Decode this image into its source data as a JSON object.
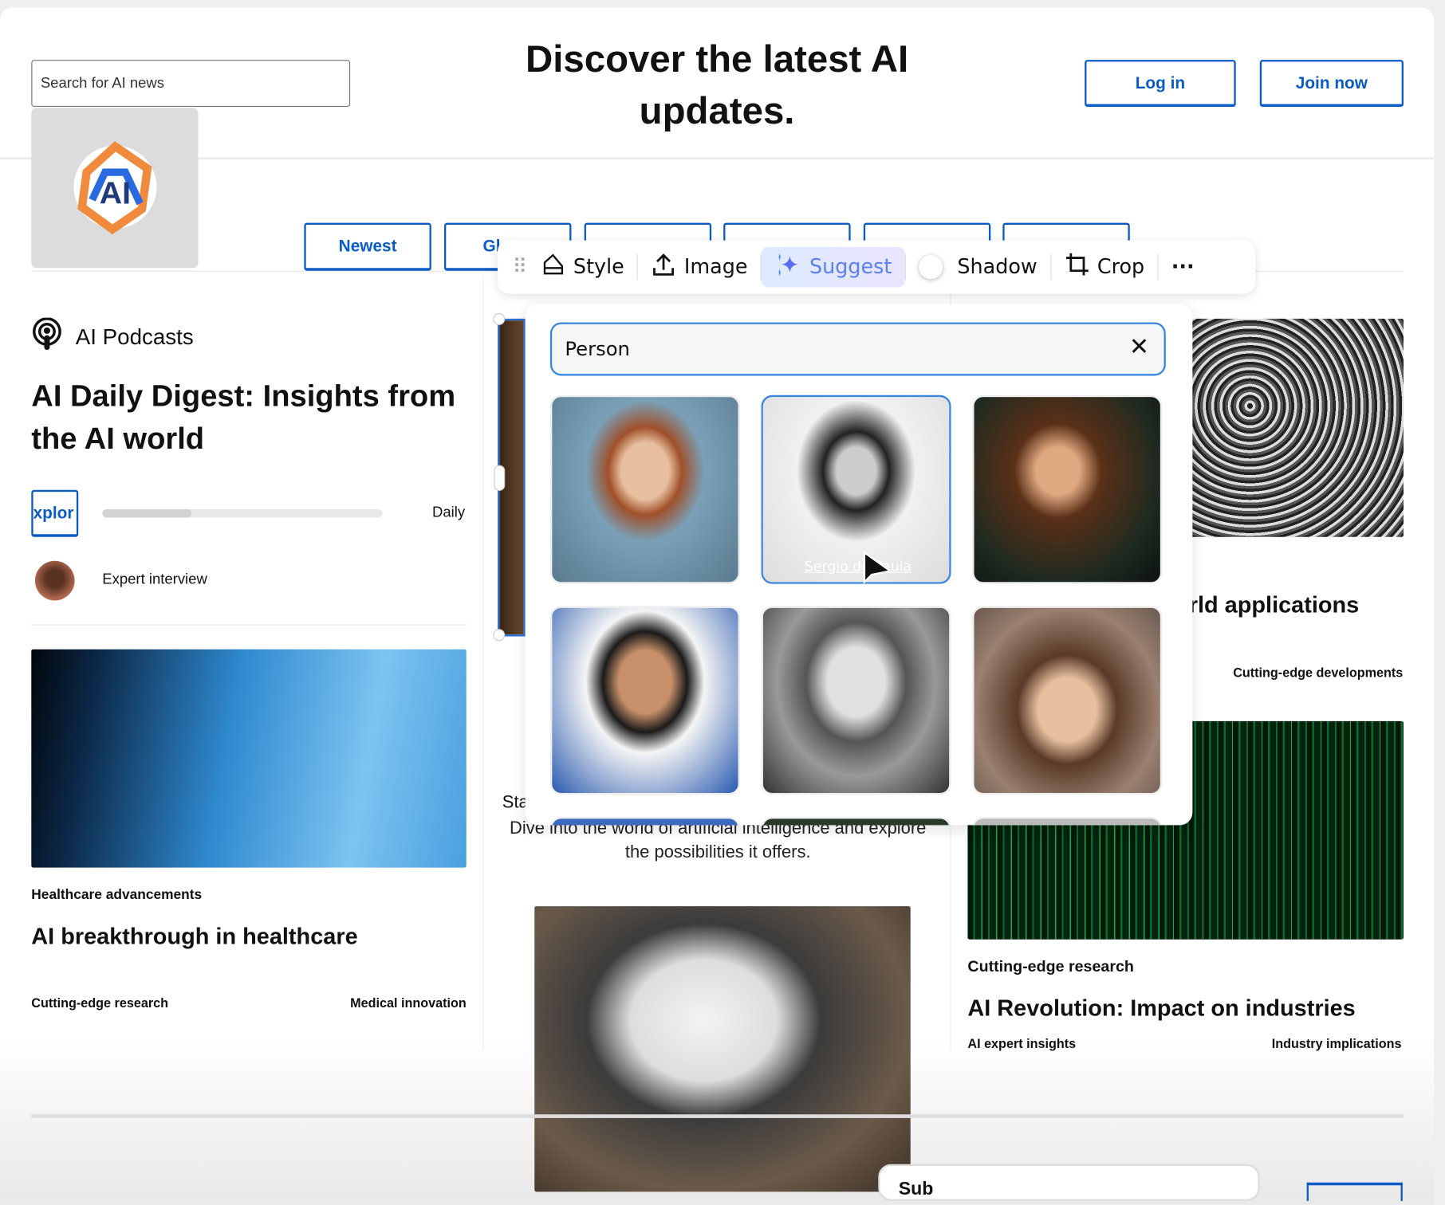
{
  "header": {
    "search_placeholder": "Search for AI news",
    "title": "Discover the latest AI updates.",
    "login": "Log in",
    "join": "Join now"
  },
  "logo": {
    "text": "AI"
  },
  "tabs": [
    "Newest",
    "Gl",
    "",
    "",
    "",
    ""
  ],
  "toolbar": {
    "style": "Style",
    "image": "Image",
    "suggest": "Suggest",
    "shadow": "Shadow",
    "crop": "Crop",
    "more": "···"
  },
  "image_search": {
    "value": "Person",
    "results": [
      {
        "credit": ""
      },
      {
        "credit": "Sergio de Paula"
      },
      {
        "credit": ""
      },
      {
        "credit": ""
      },
      {
        "credit": ""
      },
      {
        "credit": ""
      }
    ]
  },
  "left": {
    "section": "AI Podcasts",
    "headline": "AI Daily Digest: Insights from the AI world",
    "explore": "xplor",
    "progress": 0.32,
    "frequency": "Daily",
    "interview": "Expert interview",
    "card_tag": "Healthcare advancements",
    "card_title": "AI breakthrough in healthcare",
    "meta_left": "Cutting-edge research",
    "meta_right": "Medical innovation"
  },
  "middle": {
    "start": "Sta",
    "desc": "Dive into the world of artificial intelligence and explore the possibilities it offers."
  },
  "right": {
    "title_partial": "rld applications",
    "tag1": "Cutting-edge developments",
    "tag2": "Cutting-edge research",
    "title2": "AI Revolution: Impact on industries",
    "meta_left": "AI expert insights",
    "meta_right": "Industry implications"
  },
  "footer": {
    "partial": "Sub"
  }
}
